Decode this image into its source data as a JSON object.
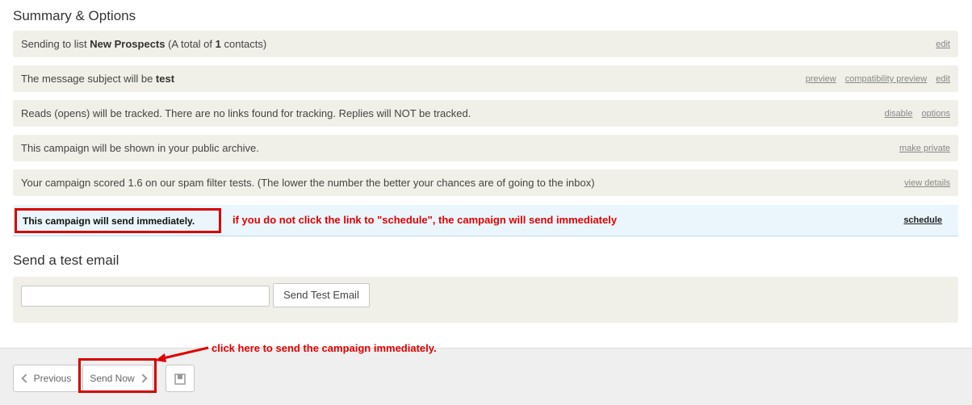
{
  "summary": {
    "title": "Summary & Options",
    "rows": [
      {
        "pre": "Sending to list ",
        "bold": "New Prospects",
        "post1": " (A total of ",
        "bold2": "1",
        "post2": " contacts)",
        "links": [
          "edit"
        ]
      },
      {
        "pre": "The message subject will be ",
        "bold": "test",
        "links": [
          "preview",
          "compatibility preview",
          "edit"
        ]
      },
      {
        "text": "Reads (opens) will be tracked. There are no links found for tracking. Replies will NOT be tracked.",
        "links": [
          "disable",
          "options"
        ]
      },
      {
        "text": "This campaign will be shown in your public archive.",
        "links": [
          "make private"
        ]
      },
      {
        "text": "Your campaign scored 1.6 on our spam filter tests. (The lower the number the better your chances are of going to the inbox)",
        "links": [
          "view details"
        ]
      }
    ],
    "schedule_row": {
      "text": "This campaign will send immediately.",
      "annotation": "if you do not click the link to \"schedule\", the campaign will send immediately",
      "link": "schedule"
    }
  },
  "test_email": {
    "title": "Send a test email",
    "input_value": "",
    "button": "Send Test Email"
  },
  "footer": {
    "previous": "Previous",
    "send_now": "Send Now",
    "annotation": "click here to send the campaign immediately."
  },
  "colors": {
    "annotation_red": "#e10000",
    "row_bg": "#f0efe8",
    "info_bg": "#eaf6fc"
  }
}
